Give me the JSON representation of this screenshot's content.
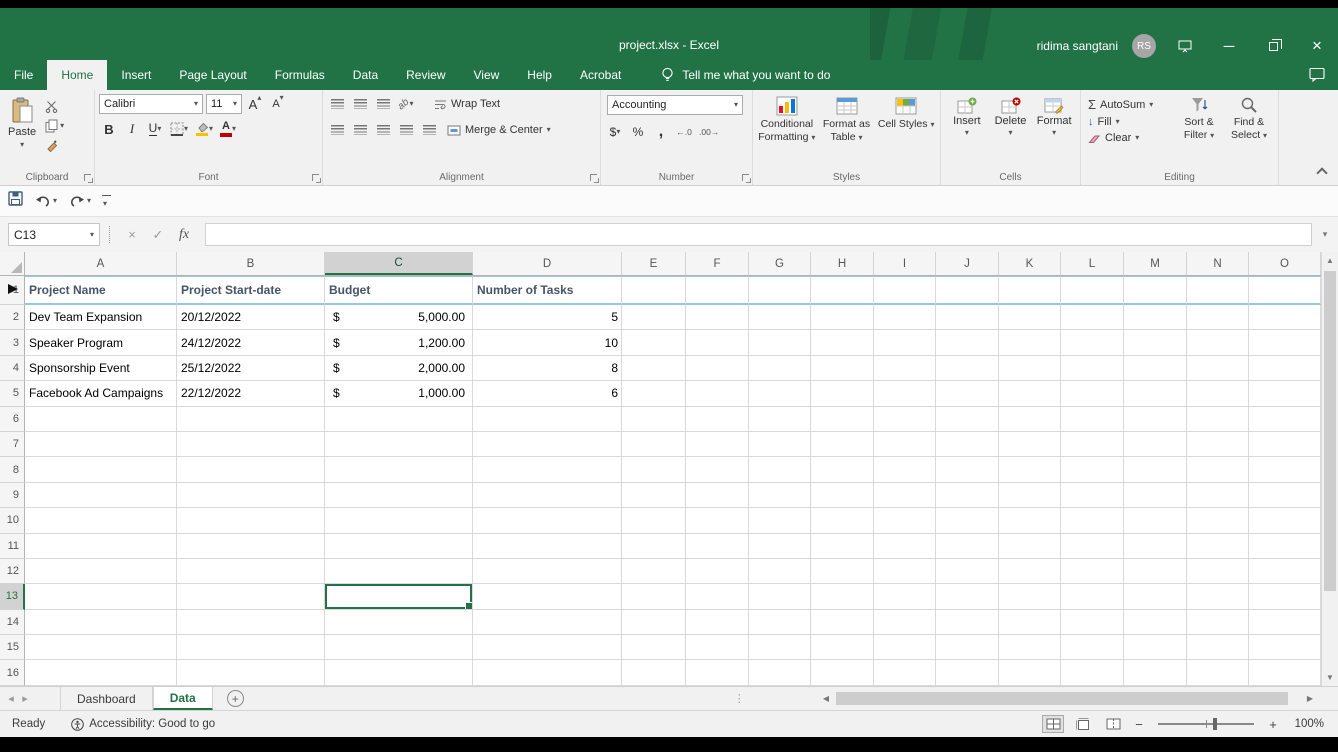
{
  "title_bar": {
    "title": "project.xlsx  -  Excel",
    "user_name": "ridima sangtani",
    "user_initials": "RS"
  },
  "ribbon_tabs": [
    {
      "label": "File",
      "active": false
    },
    {
      "label": "Home",
      "active": true
    },
    {
      "label": "Insert",
      "active": false
    },
    {
      "label": "Page Layout",
      "active": false
    },
    {
      "label": "Formulas",
      "active": false
    },
    {
      "label": "Data",
      "active": false
    },
    {
      "label": "Review",
      "active": false
    },
    {
      "label": "View",
      "active": false
    },
    {
      "label": "Help",
      "active": false
    },
    {
      "label": "Acrobat",
      "active": false
    }
  ],
  "tell_me": "Tell me what you want to do",
  "ribbon": {
    "clipboard": {
      "label": "Clipboard",
      "paste": "Paste"
    },
    "font": {
      "label": "Font",
      "font_name": "Calibri",
      "font_size": "11",
      "bold": "B",
      "italic": "I",
      "underline": "U"
    },
    "alignment": {
      "label": "Alignment",
      "wrap_text": "Wrap Text",
      "merge_center": "Merge & Center"
    },
    "number": {
      "label": "Number",
      "format": "Accounting",
      "currency": "$",
      "percent": "%",
      "comma": ","
    },
    "styles": {
      "label": "Styles",
      "conditional_formatting": "Conditional Formatting",
      "format_as_table": "Format as Table",
      "cell_styles": "Cell Styles"
    },
    "cells": {
      "label": "Cells",
      "insert": "Insert",
      "delete": "Delete",
      "format": "Format"
    },
    "editing": {
      "label": "Editing",
      "autosum": "AutoSum",
      "fill": "Fill",
      "clear": "Clear",
      "sort_filter": "Sort & Filter",
      "find_select": "Find & Select"
    }
  },
  "formula_bar": {
    "name_box": "C13",
    "fx_label": "fx",
    "formula": ""
  },
  "sheet": {
    "columns": [
      "A",
      "B",
      "C",
      "D",
      "E",
      "F",
      "G",
      "H",
      "I",
      "J",
      "K",
      "L",
      "M",
      "N",
      "O"
    ],
    "visible_rows": 16,
    "selection": {
      "cell": "C13",
      "column": "C",
      "row": 13
    },
    "header_row": {
      "A": "Project Name",
      "B": "Project Start-date",
      "C": "Budget",
      "D": "Number of Tasks"
    },
    "data_rows": [
      {
        "row": 2,
        "name": "Dev Team Expansion",
        "start_date": "20/12/2022",
        "currency": "$",
        "budget": "5,000.00",
        "tasks": "5"
      },
      {
        "row": 3,
        "name": "Speaker Program",
        "start_date": "24/12/2022",
        "currency": "$",
        "budget": "1,200.00",
        "tasks": "10"
      },
      {
        "row": 4,
        "name": "Sponsorship Event",
        "start_date": "25/12/2022",
        "currency": "$",
        "budget": "2,000.00",
        "tasks": "8"
      },
      {
        "row": 5,
        "name": "Facebook Ad Campaigns",
        "start_date": "22/12/2022",
        "currency": "$",
        "budget": "1,000.00",
        "tasks": "6"
      }
    ]
  },
  "sheet_tabs": [
    {
      "label": "Dashboard",
      "active": false
    },
    {
      "label": "Data",
      "active": true
    }
  ],
  "status_bar": {
    "mode": "Ready",
    "accessibility": "Accessibility: Good to go",
    "zoom": "100%"
  },
  "colors": {
    "excel_green": "#217346",
    "header_text": "#44546A",
    "table_border_blue": "#9DC3E6",
    "selection_border": "#217346"
  }
}
